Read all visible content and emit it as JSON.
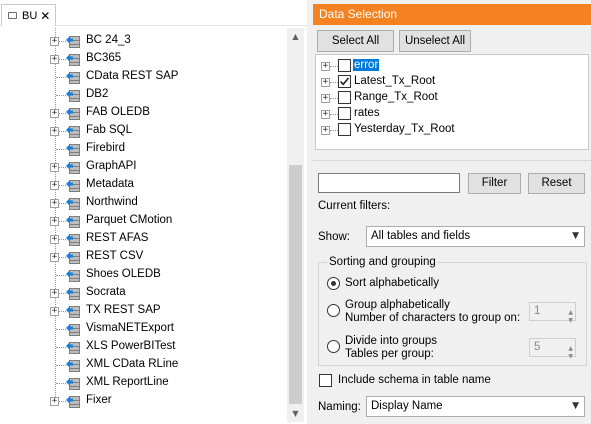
{
  "tab": {
    "label": "BU",
    "close_glyph": "✕"
  },
  "tree": {
    "items": [
      {
        "label": "BC 24_3",
        "expandable": true
      },
      {
        "label": "BC365",
        "expandable": true
      },
      {
        "label": "CData REST SAP",
        "expandable": false
      },
      {
        "label": "DB2",
        "expandable": false
      },
      {
        "label": "FAB OLEDB",
        "expandable": true
      },
      {
        "label": "Fab SQL",
        "expandable": true
      },
      {
        "label": "Firebird",
        "expandable": false
      },
      {
        "label": "GraphAPI",
        "expandable": true
      },
      {
        "label": "Metadata",
        "expandable": true
      },
      {
        "label": "Northwind",
        "expandable": true
      },
      {
        "label": "Parquet CMotion",
        "expandable": true
      },
      {
        "label": "REST AFAS",
        "expandable": true
      },
      {
        "label": "REST CSV",
        "expandable": true
      },
      {
        "label": "Shoes OLEDB",
        "expandable": false
      },
      {
        "label": "Socrata",
        "expandable": true
      },
      {
        "label": "TX REST SAP",
        "expandable": true
      },
      {
        "label": "VismaNETExport",
        "expandable": false
      },
      {
        "label": "XLS PowerBITest",
        "expandable": false
      },
      {
        "label": "XML CData RLine",
        "expandable": false
      },
      {
        "label": "XML ReportLine",
        "expandable": false
      },
      {
        "label": "Fixer",
        "expandable": true,
        "selected": true
      }
    ]
  },
  "data_selection": {
    "header": "Data Selection",
    "select_all": "Select All",
    "unselect_all": "Unselect All",
    "fields": [
      {
        "label": "error",
        "checked": false,
        "highlighted": true
      },
      {
        "label": "Latest_Tx_Root",
        "checked": true,
        "highlighted": false
      },
      {
        "label": "Range_Tx_Root",
        "checked": false,
        "highlighted": false
      },
      {
        "label": "rates",
        "checked": false,
        "highlighted": false
      },
      {
        "label": "Yesterday_Tx_Root",
        "checked": false,
        "highlighted": false
      }
    ]
  },
  "filters": {
    "input_value": "",
    "filter_button": "Filter",
    "reset_button": "Reset",
    "current_filters_label": "Current filters:",
    "show_label": "Show:",
    "show_value": "All tables and fields"
  },
  "sorting": {
    "legend": "Sorting and grouping",
    "sort_alpha": "Sort alphabetically",
    "group_alpha": "Group alphabetically",
    "group_alpha_sub": "Number of characters to group on:",
    "group_alpha_value": "1",
    "divide_groups": "Divide into groups",
    "divide_groups_sub": "Tables per group:",
    "divide_groups_value": "5",
    "selected_option": "sort_alpha"
  },
  "include_schema_label": "Include schema in table name",
  "naming": {
    "label": "Naming:",
    "value": "Display Name"
  },
  "icons": {
    "expand": "+",
    "dropdown": "chevron-down-icon",
    "spin_up": "▲",
    "spin_down": "▼",
    "scroll_up": "▲",
    "scroll_down": "▼"
  }
}
